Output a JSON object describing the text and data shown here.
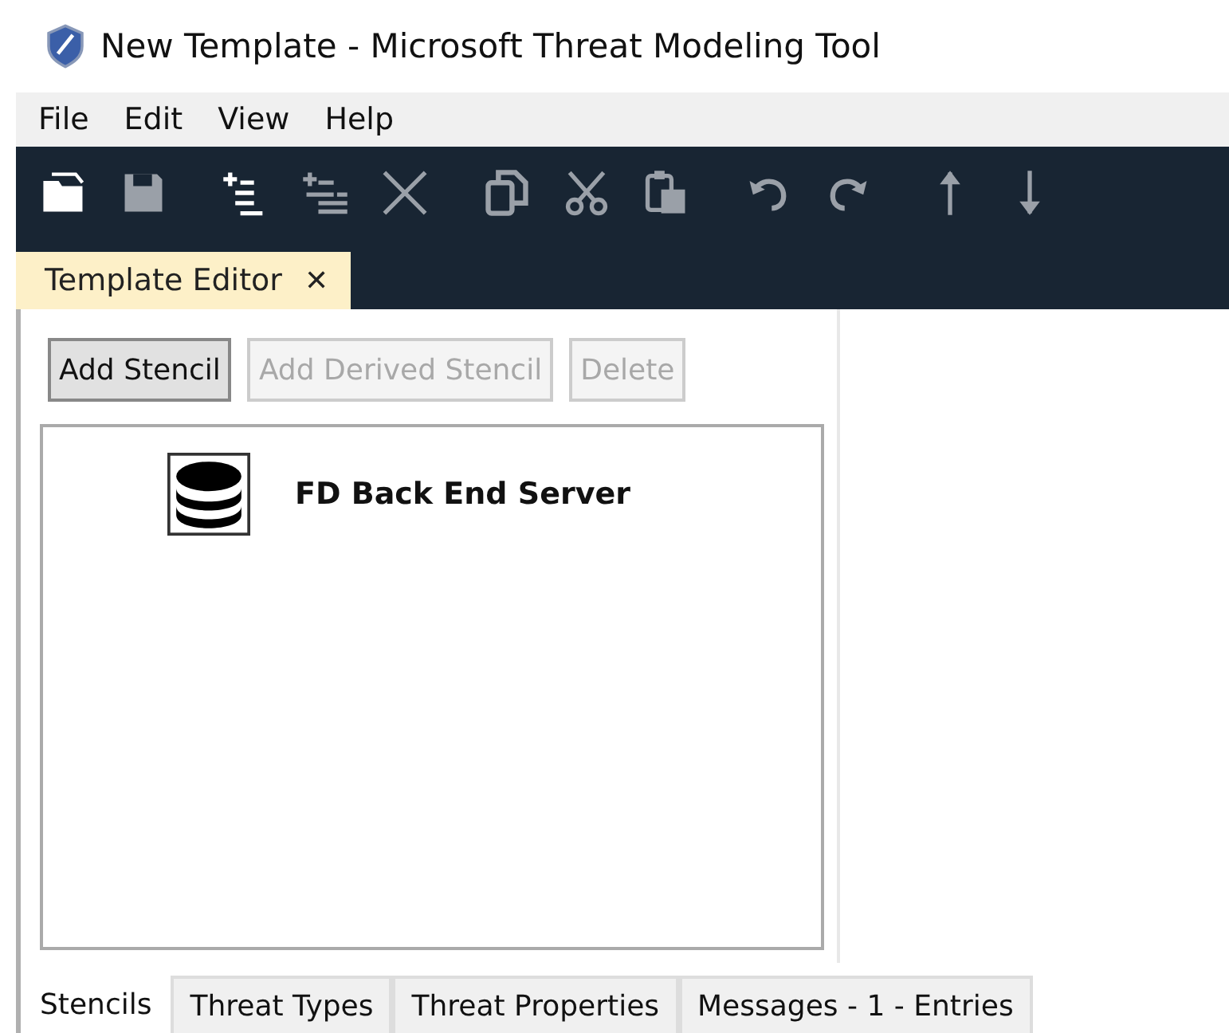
{
  "window": {
    "title": "New Template - Microsoft Threat Modeling Tool"
  },
  "menu": [
    "File",
    "Edit",
    "View",
    "Help"
  ],
  "toolbar": [
    {
      "kind": "open",
      "disabled": false
    },
    {
      "kind": "save",
      "disabled": true
    },
    {
      "kind": "add-child",
      "disabled": false
    },
    {
      "kind": "add-sibling",
      "disabled": true
    },
    {
      "kind": "delete",
      "disabled": true
    },
    {
      "kind": "copy",
      "disabled": true
    },
    {
      "kind": "cut",
      "disabled": true
    },
    {
      "kind": "paste",
      "disabled": true
    },
    {
      "kind": "undo",
      "disabled": true
    },
    {
      "kind": "redo",
      "disabled": true
    },
    {
      "kind": "up",
      "disabled": true
    },
    {
      "kind": "down",
      "disabled": true
    }
  ],
  "document_tabs": [
    {
      "label": "Template Editor",
      "close": "✕",
      "selected": true
    }
  ],
  "buttons": [
    {
      "label": "Add Stencil",
      "disabled": false
    },
    {
      "label": "Add Derived Stencil",
      "disabled": true
    },
    {
      "label": "Delete",
      "disabled": true
    }
  ],
  "stencils": [
    {
      "label": "FD Back End Server",
      "kind": "database"
    }
  ],
  "bottom_tabs": [
    {
      "label": "Stencils",
      "selected": true
    },
    {
      "label": "Threat Types",
      "selected": false
    },
    {
      "label": "Threat Properties",
      "selected": false
    },
    {
      "label": "Messages - 1 - Entries",
      "selected": false
    }
  ]
}
